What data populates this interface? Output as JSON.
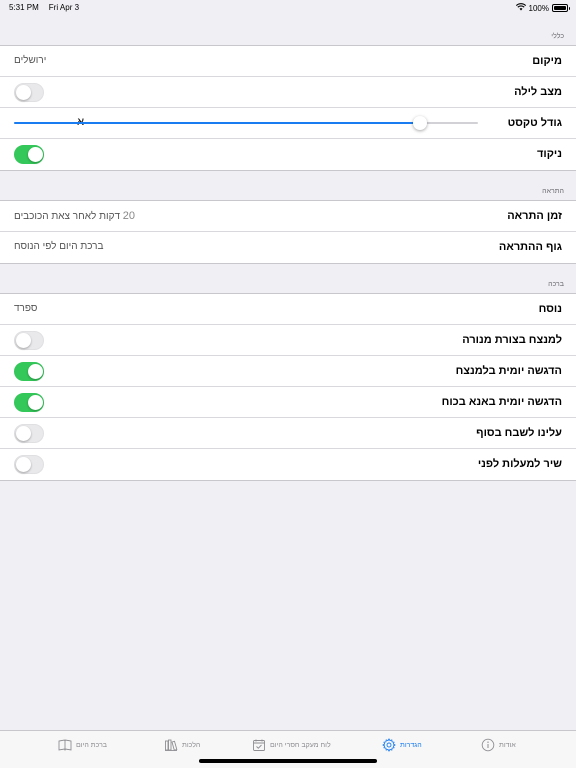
{
  "status_bar": {
    "time": "5:31 PM",
    "date": "Fri Apr 3",
    "battery": "100%"
  },
  "sections": {
    "general": {
      "header": "כללי",
      "location": {
        "label": "מיקום",
        "value": "ירושלים"
      },
      "night_mode": {
        "label": "מצב לילה",
        "on": false
      },
      "text_size": {
        "label": "גודל טקסט",
        "letter": "א",
        "value_fraction": 0.875
      },
      "nikud": {
        "label": "ניקוד",
        "on": true
      }
    },
    "notification": {
      "header": "התראה",
      "time": {
        "label": "זמן התראה",
        "number": "20",
        "value": "דקות לאחר צאת הכוכבים"
      },
      "body": {
        "label": "גוף ההתראה",
        "value": "ברכת היום לפי הנוסח"
      }
    },
    "blessing": {
      "header": "ברכה",
      "nusach": {
        "label": "נוסח",
        "value": "ספרד"
      },
      "menorah": {
        "label": "למנצח בצורת מנורה",
        "on": false
      },
      "daily_lamnatzeach": {
        "label": "הדגשה יומית בלמנצח",
        "on": true
      },
      "daily_ana": {
        "label": "הדגשה יומית באנא בכוח",
        "on": true
      },
      "aleinu": {
        "label": "עלינו לשבח בסוף",
        "on": false
      },
      "shir_hamaalot": {
        "label": "שיר למעלות לפני",
        "on": false
      }
    }
  },
  "tab_bar": {
    "about": "אודות",
    "settings": "הגדרות",
    "calendar": "לוח מעקב חסרי היום",
    "halachot": "הלכות",
    "blessing_of_day": "ברכת היום",
    "active_color": "#1a7cf1",
    "inactive_color": "#8e8e93"
  },
  "colors": {
    "toggle_on": "#34c759",
    "accent": "#1a7cf1"
  }
}
